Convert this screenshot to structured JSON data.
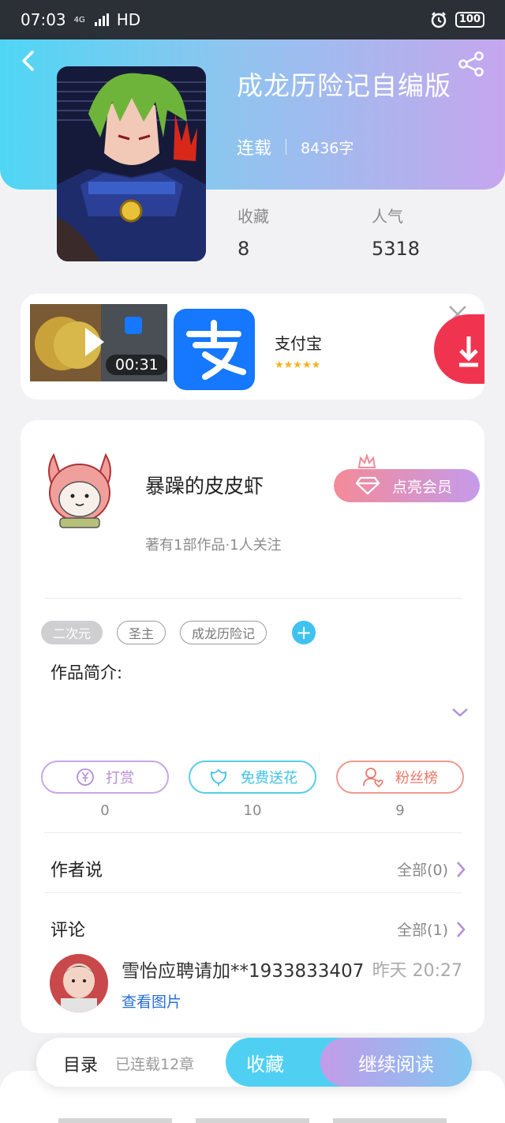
{
  "status_bar": {
    "time": "07:03",
    "network": "4G",
    "hd": "HD",
    "battery": "100"
  },
  "book": {
    "title": "成龙历险记自编版",
    "status": "连载",
    "word_count": "8436字"
  },
  "stats": [
    {
      "label": "收藏",
      "value": "8"
    },
    {
      "label": "人气",
      "value": "5318"
    }
  ],
  "ad": {
    "video_duration": "00:31",
    "app_name": "支付宝",
    "stars": "★★★★★",
    "icon_char": "支"
  },
  "author": {
    "name": "暴躁的皮皮虾",
    "vip_button": "点亮会员",
    "info": "著有1部作品·1人关注"
  },
  "tags": [
    "二次元",
    "圣主",
    "成龙历险记"
  ],
  "intro_label": "作品简介:",
  "actions": [
    {
      "label": "打赏",
      "count": "0",
      "color": "#c9a6e6",
      "text_color": "#b48ed8"
    },
    {
      "label": "免费送花",
      "count": "10",
      "color": "#56cde8",
      "text_color": "#3fc2e2"
    },
    {
      "label": "粉丝榜",
      "count": "9",
      "color": "#ef9a8f",
      "text_color": "#e9786a"
    }
  ],
  "author_says": {
    "title": "作者说",
    "more": "全部(0)"
  },
  "comments": {
    "title": "评论",
    "more": "全部(1)",
    "items": [
      {
        "user": "雪怡应聘请加**1933833407",
        "time": "昨天 20:27",
        "link": "查看图片"
      }
    ]
  },
  "bottom_bar": {
    "toc": "目录",
    "chapters": "已连载12章",
    "collect": "收藏",
    "continue": "继续阅读"
  }
}
